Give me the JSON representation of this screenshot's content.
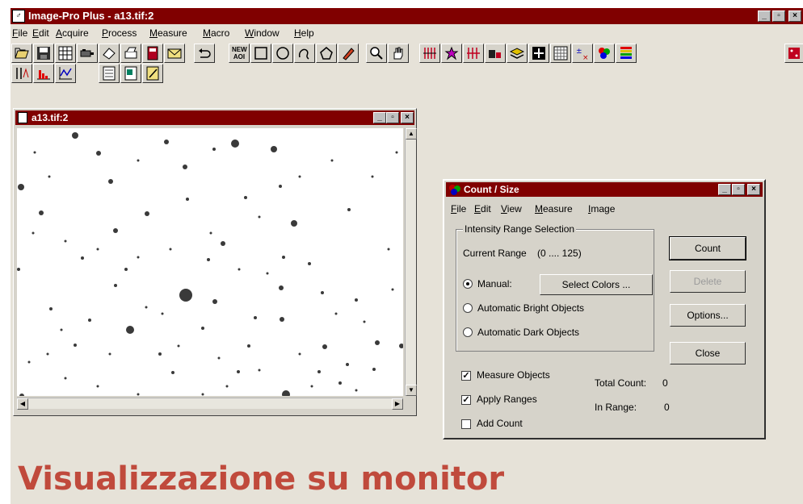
{
  "app": {
    "title": "Image-Pro Plus - a13.tif:2"
  },
  "window_controls": {
    "minimize": "_",
    "restore": "▫",
    "close": "×"
  },
  "menu": [
    "File",
    "Edit",
    "Acquire",
    "Process",
    "Measure",
    "Macro",
    "Window",
    "Help"
  ],
  "toolbar": {
    "row1": [
      "open-icon",
      "save-icon",
      "grid-icon",
      "camera-icon",
      "eraser-icon",
      "print-icon",
      "book-icon",
      "envelope-icon",
      "undo-icon",
      "new-aoi-icon",
      "rectangle-icon",
      "ellipse-icon",
      "freehand-icon",
      "polygon-icon",
      "pencil-icon",
      "zoom-icon",
      "hand-icon",
      "measure-lines-icon",
      "star-icon",
      "columns-icon",
      "bar-icon",
      "layers-icon",
      "cross-icon",
      "pixel-grid-icon",
      "plus-minus-icon",
      "colors-icon",
      "palette-icon",
      "dice-icon"
    ],
    "row2": [
      "line-profile-icon",
      "histogram-icon",
      "graph-icon",
      "calc-icon",
      "sheet-icon",
      "note-icon"
    ],
    "new_aoi_label": "NEW AOI"
  },
  "image_window": {
    "title": "a13.tif:2"
  },
  "count_dialog": {
    "title": "Count / Size",
    "menu": [
      "File",
      "Edit",
      "View",
      "Measure",
      "Image"
    ],
    "group_label": "Intensity Range Selection",
    "current_range_label": "Current Range",
    "current_range_value": "(0 .... 125)",
    "radios": {
      "manual": "Manual:",
      "auto_bright": "Automatic Bright Objects",
      "auto_dark": "Automatic Dark Objects"
    },
    "select_colors_button": "Select Colors ...",
    "checkboxes": {
      "measure_objects": "Measure Objects",
      "apply_ranges": "Apply Ranges",
      "add_count": "Add Count"
    },
    "total_count_label": "Total Count:",
    "total_count_value": "0",
    "in_range_label": "In Range:",
    "in_range_value": "0",
    "buttons": {
      "count": "Count",
      "delete": "Delete",
      "options": "Options...",
      "close": "Close"
    }
  },
  "caption": "Visualizzazione su monitor"
}
